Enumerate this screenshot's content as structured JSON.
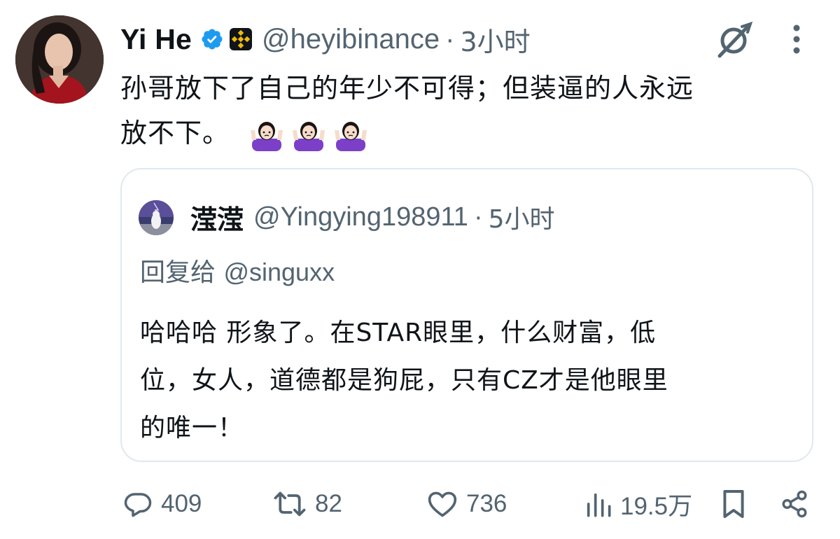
{
  "tweet": {
    "author": {
      "display_name": "Yi He",
      "handle": "@heyibinance",
      "verified_icon": "verified-badge-icon",
      "affiliate_icon": "binance-logo-icon"
    },
    "separator": "·",
    "time": "3小时",
    "text_line1": "孙哥放下了自己的年少不可得；但装逼的人永远",
    "text_line2": "放不下。",
    "emoji": [
      "person-shrugging-emoji",
      "person-shrugging-emoji",
      "person-shrugging-emoji"
    ]
  },
  "quote": {
    "author": {
      "display_name": "滢滢",
      "handle": "@Yingying198911"
    },
    "separator": "·",
    "time": "5小时",
    "reply_prefix": "回复给",
    "reply_handle": "@singuxx",
    "text_line1": "哈哈哈 形象了。在STAR眼里，什么财富，低",
    "text_line2": "位，女人，道德都是狗屁，只有CZ才是他眼里",
    "text_line3": "的唯一！"
  },
  "actions": {
    "replies": "409",
    "retweets": "82",
    "likes": "736",
    "views": "19.5万"
  },
  "icons": {
    "grok": "grok-icon",
    "more": "more-vertical-icon",
    "reply": "reply-icon",
    "retweet": "retweet-icon",
    "like": "heart-icon",
    "views": "views-chart-icon",
    "bookmark": "bookmark-icon",
    "share": "share-icon"
  },
  "colors": {
    "text": "#0f1419",
    "secondary": "#536471",
    "verified": "#1d9bf0",
    "binance": "#f0b90b",
    "border": "#e1e8ed"
  }
}
